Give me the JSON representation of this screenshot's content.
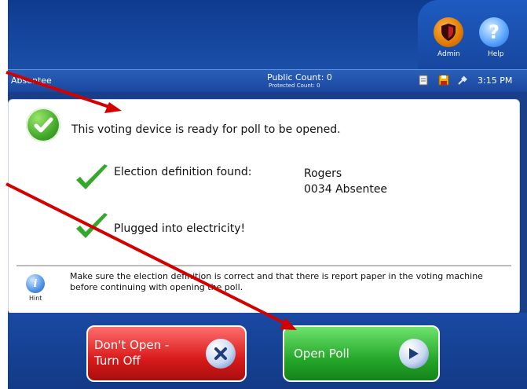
{
  "header": {
    "admin_label": "Admin",
    "help_label": "Help"
  },
  "statusbar": {
    "left_text": "Absentee",
    "public_count": "Public Count: 0",
    "protected_count": "Protected Count: 0",
    "time": "3:15 PM"
  },
  "panel": {
    "main_message": "This voting device is ready for poll to be opened.",
    "election_label": "Election definition found:",
    "election_name": "Rogers",
    "election_precinct": "0034 Absentee",
    "power_message": "Plugged into electricity!",
    "hint_label": "Hint",
    "hint_text": "Make sure the election definition is correct and that there is report paper in the voting machine before continuing with opening the poll."
  },
  "buttons": {
    "dont_open": "Don't Open - Turn Off",
    "open_poll": "Open Poll"
  },
  "icons": {
    "admin": "shield-icon",
    "help": "question-mark-icon",
    "save": "save-icon",
    "document": "document-icon",
    "power": "power-plug-icon"
  },
  "colors": {
    "screen_blue": "#1a3f8a",
    "check_green": "#3fa628",
    "dont_open_red": "#d91a1a",
    "open_poll_green": "#25a82a",
    "annotation_arrow_red": "#d40000"
  }
}
